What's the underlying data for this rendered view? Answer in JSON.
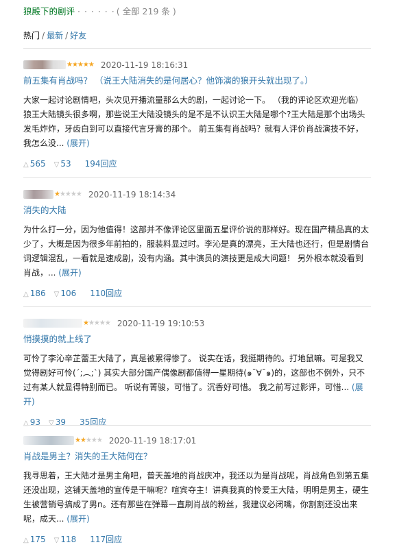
{
  "header": {
    "title": "狼殿下的剧评",
    "dots": "· · · · · ·",
    "count": "( 全部 219 条 )",
    "sort": {
      "hot": "热门",
      "latest": "最新",
      "friends": "好友"
    }
  },
  "reviews": [
    {
      "rating": 5,
      "time": "2020-11-19 18:16:31",
      "title": "前五集有肖战吗？ （说王大陆消失的是何居心？他饰演的狼开头就出现了。）",
      "text": "大家一起讨论剧情吧，头次见开播流量那么大的剧，一起讨论一下。 （我的评论区欢迎光临）狼王大陆镜头很多啊，那些说王大陆没镜头的是不是不认识王大陆是哪个?王大陆是那个出场头发毛炸炸，牙齿白到可以直接代言牙膏的那个。 前五集有肖战吗？就有人评价肖战演技不好，我怎么没...",
      "more": "(展开)",
      "useful": "565",
      "useless": "53",
      "replies": "194回应"
    },
    {
      "rating": 1,
      "time": "2020-11-19 18:14:34",
      "title": "消失的大陆",
      "text": "为什么打一分，因为他值得！这部并不像评论区里面五星评价说的那样好。现在国产精品真的太少了，大概是因为很多年前拍的，服装料显过时。李沁是真的漂亮，王大陆也还行，但是剧情台词逻辑混乱，一看就是速成剧，没有内涵。其中演员的演技更是成大问题！ 另外根本就没看到肖战，...",
      "more": "(展开)",
      "useful": "186",
      "useless": "106",
      "replies": "110回应"
    },
    {
      "rating": 1,
      "time": "2020-11-19 19:10:53",
      "title": "悄摸摸的就上线了",
      "text": "可怜了李沁辛芷蕾王大陆了，真是被累得惨了。 说实在话，我挺期待的。打地鼠嘛。可是我又觉得剧好可怜(´;︵;`) 其实大部分国产偶像剧都值得一星期待(๑¯∀¯๑)的，这部也不例外，只不过有某人就显得特别而已。 听说有菁骏，可惜了。沉香好可惜。 我之前写过影评，可惜...",
      "more": "(展开)",
      "useful": "93",
      "useless": "39",
      "replies": "35回应"
    },
    {
      "rating": 2,
      "time": "2020-11-19 18:17:01",
      "title": "肖战是男主？消失的王大陆何在？",
      "text": "我寻思着，王大陆才是男主角吧，普天盖地的肖战庆冲，我还以为是肖战呢，肖战角色到第五集还没出现，这铺天盖地的宣传是干嘛呢？喧宾夺主！讲真我真的怜爱王大陆，明明是男主，硬生生被营销号搞成了男n。还有那些在弹幕一直刷肖战的粉丝，我建议必闭嘴，你割割还没出来呢，成天...",
      "more": "(展开)",
      "useful": "175",
      "useless": "118",
      "replies": "117回应"
    }
  ],
  "colors": {
    "link": "#3377aa",
    "title_green": "#007722",
    "star": "#f5a623"
  }
}
